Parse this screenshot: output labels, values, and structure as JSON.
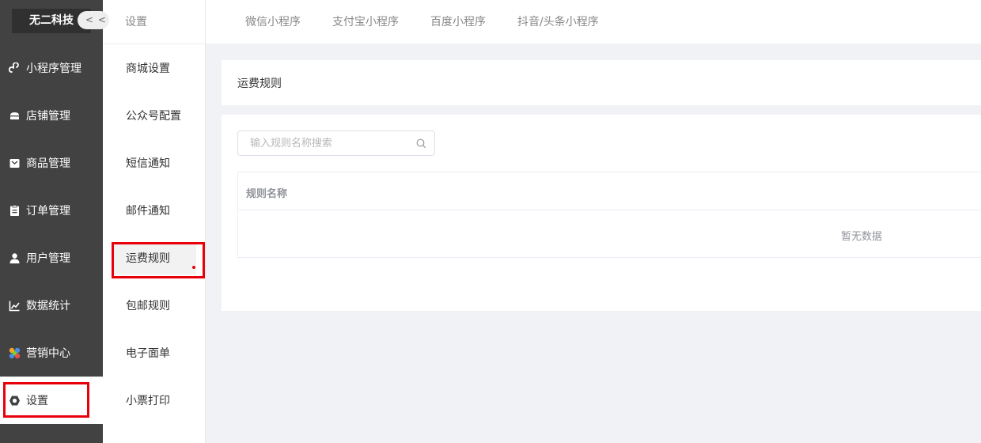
{
  "brand": "无二科技",
  "sidebar": {
    "items": [
      {
        "label": "小程序管理",
        "icon": "link-icon"
      },
      {
        "label": "店铺管理",
        "icon": "shop-icon"
      },
      {
        "label": "商品管理",
        "icon": "goods-icon"
      },
      {
        "label": "订单管理",
        "icon": "order-icon"
      },
      {
        "label": "用户管理",
        "icon": "user-icon"
      },
      {
        "label": "数据统计",
        "icon": "chart-icon"
      },
      {
        "label": "营销中心",
        "icon": "marketing-icon"
      },
      {
        "label": "设置",
        "icon": "settings-icon",
        "active": true
      }
    ]
  },
  "submenu": {
    "title": "设置",
    "collapse": "< <",
    "items": [
      {
        "label": "商城设置"
      },
      {
        "label": "公众号配置"
      },
      {
        "label": "短信通知"
      },
      {
        "label": "邮件通知"
      },
      {
        "label": "运费规则",
        "active": true
      },
      {
        "label": "包邮规则"
      },
      {
        "label": "电子面单"
      },
      {
        "label": "小票打印"
      }
    ]
  },
  "tabs": [
    "微信小程序",
    "支付宝小程序",
    "百度小程序",
    "抖音/头条小程序"
  ],
  "content": {
    "title": "运费规则",
    "search_placeholder": "输入规则名称搜索",
    "column_rule_name": "规则名称",
    "empty_text": "暂无数据"
  },
  "colors": {
    "sidebar_bg": "#424242",
    "brand_bg": "#303030",
    "highlight_red": "#e8000b",
    "page_bg": "#f0f2f5"
  }
}
